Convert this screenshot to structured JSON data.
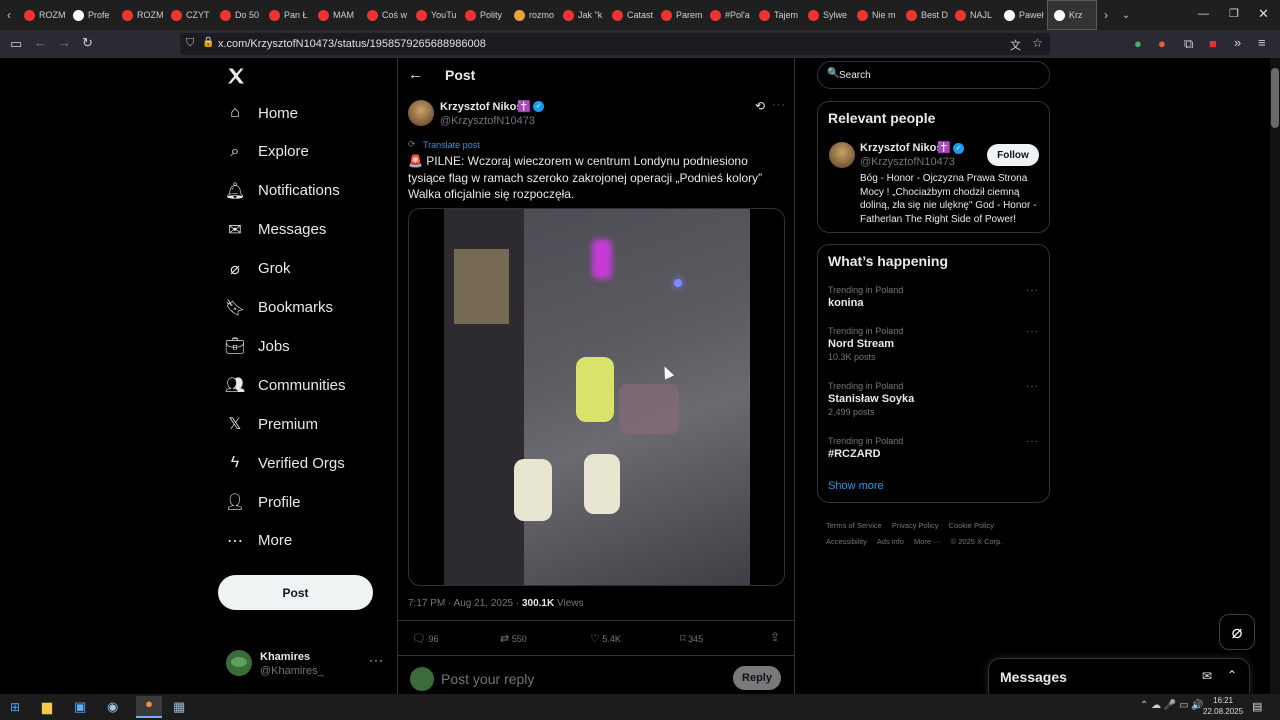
{
  "browser": {
    "tabs": [
      "ROZM",
      "Profe",
      "ROZM",
      "CZYT",
      "Do 50",
      "Pan Ł",
      "MAM",
      "Coś w",
      "YouTu",
      "Polity",
      "rozmo",
      "Jak \"k",
      "Catast",
      "Parem",
      "#Pol'a",
      "Tajem",
      "Sylwe",
      "Nie m",
      "Best D",
      "NAJL",
      "Paweł",
      "Krz"
    ],
    "url": "x.com/KrzysztofN10473/status/1958579265688986008"
  },
  "sidebar": {
    "items": [
      {
        "label": "Home",
        "icon": "home-icon"
      },
      {
        "label": "Explore",
        "icon": "search-icon"
      },
      {
        "label": "Notifications",
        "icon": "bell-icon"
      },
      {
        "label": "Messages",
        "icon": "mail-icon"
      },
      {
        "label": "Grok",
        "icon": "grok-icon"
      },
      {
        "label": "Bookmarks",
        "icon": "bookmark-icon"
      },
      {
        "label": "Jobs",
        "icon": "briefcase-icon"
      },
      {
        "label": "Communities",
        "icon": "people-icon"
      },
      {
        "label": "Premium",
        "icon": "x-logo-icon"
      },
      {
        "label": "Verified Orgs",
        "icon": "lightning-icon"
      },
      {
        "label": "Profile",
        "icon": "person-icon"
      },
      {
        "label": "More",
        "icon": "more-circle-icon"
      }
    ],
    "post_button": "Post",
    "account": {
      "name": "Khamires",
      "handle": "@Khamires_"
    }
  },
  "header": {
    "title": "Post"
  },
  "post": {
    "author_name": "Krzysztof Nikos",
    "author_badge": "✝️",
    "handle": "@KrzysztofN10473",
    "translate": "Translate post",
    "text": "🚨 PILNE: Wczoraj wieczorem w centrum Londynu podniesiono tysiące flag w ramach szeroko zakrojonej operacji „Podnieś kolory” Walka oficjalnie się rozpoczęła.",
    "time": "7:17 PM · Aug 21, 2025 · ",
    "views_count": "300.1K",
    "views_label": " Views",
    "replies": "96",
    "reposts": "550",
    "likes": "5.4K",
    "bookmarks": "345",
    "reply_placeholder": "Post your reply",
    "reply_button": "Reply"
  },
  "search": {
    "placeholder": "Search"
  },
  "relevant": {
    "title": "Relevant people",
    "name": "Krzysztof Nikos",
    "badge": "✝️",
    "handle": "@KrzysztofN10473",
    "follow": "Follow",
    "bio": "Bóg - Honor - Ojczyzna Prawa Strona Mocy ! „Chociażbym chodził ciemną doliną, zła się nie ulęknę\" God - Honor - Fatherlan The Right Side of Power!"
  },
  "trends": {
    "title": "What’s happening",
    "items": [
      {
        "context": "Trending in Poland",
        "name": "konina",
        "count": ""
      },
      {
        "context": "Trending in Poland",
        "name": "Nord Stream",
        "count": "10.3K posts"
      },
      {
        "context": "Trending in Poland",
        "name": "Stanisław Soyka",
        "count": "2,499 posts"
      },
      {
        "context": "Trending in Poland",
        "name": "#RCZARD",
        "count": ""
      }
    ],
    "show_more": "Show more"
  },
  "footer": {
    "links": [
      "Terms of Service",
      "Privacy Policy",
      "Cookie Policy",
      "Accessibility",
      "Ads info",
      "More ···",
      "© 2025 X Corp."
    ]
  },
  "messages": {
    "title": "Messages"
  },
  "taskbar": {
    "time": "16:21",
    "date": "22.08.2025"
  },
  "colors": {
    "accent": "#1d9bf0",
    "bg": "#000000",
    "border": "#2f3336",
    "muted": "#71767b"
  }
}
